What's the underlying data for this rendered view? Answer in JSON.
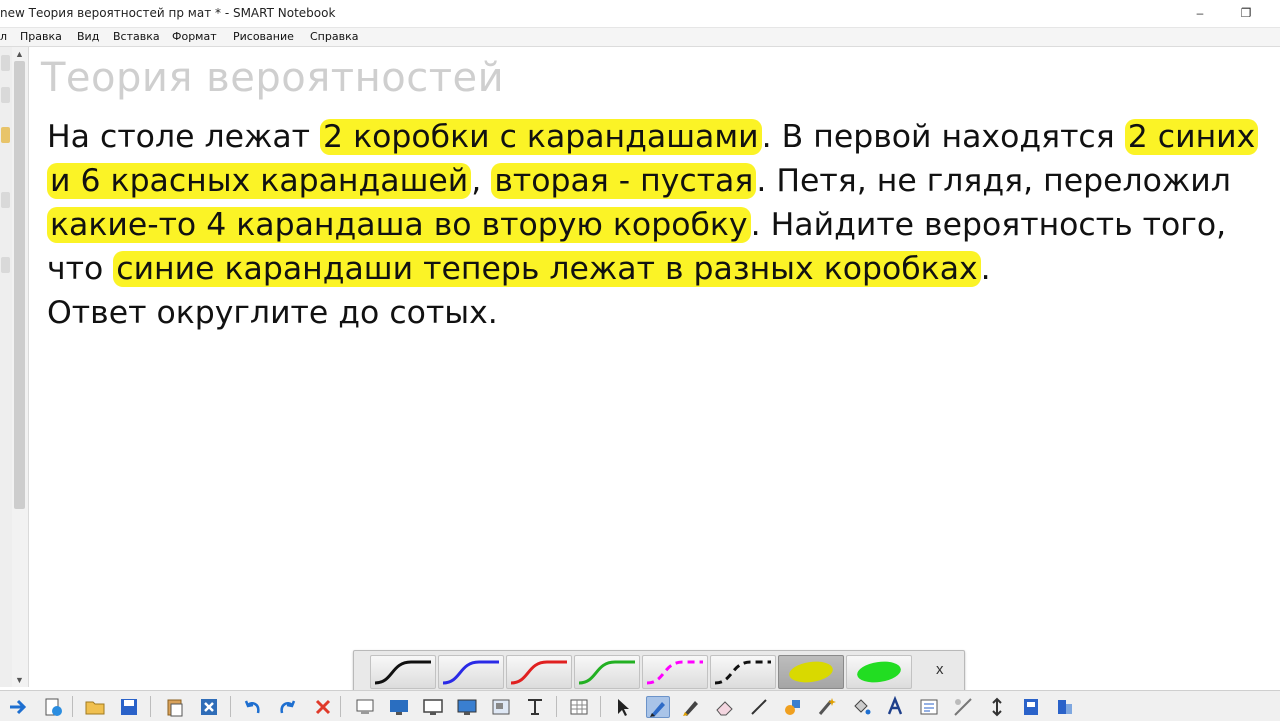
{
  "window": {
    "title": "new Теория вероятностей пр мат * - SMART Notebook",
    "minimize_glyph": "–",
    "restore_glyph": "❐"
  },
  "menu": [
    "л",
    "Правка",
    "Вид",
    "Вставка",
    "Формат",
    "Рисование",
    "Справка"
  ],
  "page": {
    "title": "Теория вероятностей",
    "task_lines": [
      [
        {
          "t": "На столе лежат "
        },
        {
          "t": "2 коробки с карандашами",
          "hl": true
        },
        {
          "t": ". В первой находятся "
        },
        {
          "t": "2 синих",
          "hl": true
        }
      ],
      [
        {
          "t": "и 6 красных карандашей",
          "hl": true
        },
        {
          "t": ", "
        },
        {
          "t": "вторая - пустая",
          "hl": true
        },
        {
          "t": ". Петя, не глядя, переложил"
        }
      ],
      [
        {
          "t": "какие-то 4 карандаша во вторую коробку",
          "hl": true
        },
        {
          "t": ". Найдите вероятность того,"
        }
      ],
      [
        {
          "t": "что "
        },
        {
          "t": "синие карандаши теперь лежат в разных коробках",
          "hl": true
        },
        {
          "t": "."
        }
      ],
      [
        {
          "t": "Ответ округлите до сотых."
        }
      ]
    ],
    "highlight_color": "#fbf326"
  },
  "pen_toolbar": {
    "pens": [
      {
        "name": "black-pen",
        "color": "#111111",
        "style": "solid"
      },
      {
        "name": "blue-pen",
        "color": "#2a2ae6",
        "style": "solid"
      },
      {
        "name": "red-pen",
        "color": "#e02020",
        "style": "solid"
      },
      {
        "name": "green-pen",
        "color": "#22b022",
        "style": "solid"
      },
      {
        "name": "magenta-dashed-pen",
        "color": "#ff00ff",
        "style": "dashed"
      },
      {
        "name": "black-dashed-pen",
        "color": "#111111",
        "style": "dashed"
      },
      {
        "name": "yellow-highlighter",
        "color": "#d9d900",
        "style": "highlighter",
        "active": true
      },
      {
        "name": "green-highlighter",
        "color": "#22dd22",
        "style": "highlighter"
      }
    ],
    "close_label": "x"
  },
  "bottom_toolbar": {
    "icons": [
      "forward-arrow-icon",
      "page-add-icon",
      "open-folder-icon",
      "save-icon",
      "paste-icon",
      "delete-page-icon",
      "undo-icon",
      "redo-icon",
      "delete-icon",
      "screen-shade-icon",
      "display-icon",
      "monitor-icon",
      "desktop-icon",
      "capture-icon",
      "text-tool-icon",
      "table-icon",
      "select-arrow-icon",
      "pen-icon",
      "creative-pen-icon",
      "eraser-icon",
      "line-icon",
      "shape-icon",
      "magic-pen-icon",
      "fill-icon",
      "text-icon",
      "properties-icon",
      "measure-icon",
      "move-toolbar-icon",
      "document-camera-icon",
      "addons-icon"
    ]
  }
}
